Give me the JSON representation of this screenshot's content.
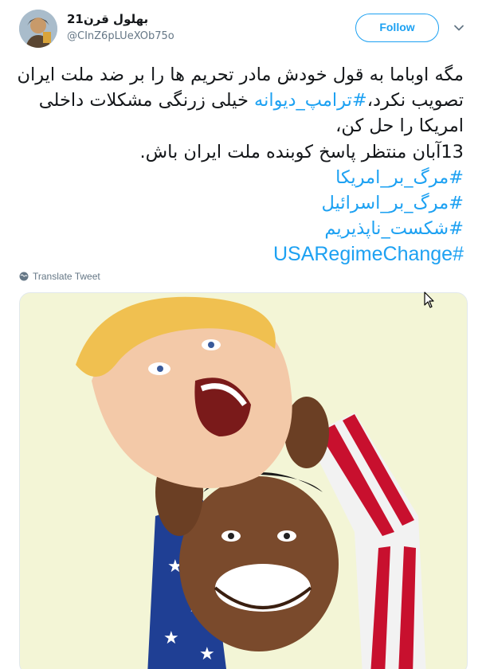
{
  "user": {
    "display_name": "بهلول قرن21",
    "handle": "@CInZ6pLUeXOb75o"
  },
  "follow_label": "Follow",
  "tweet": {
    "line1": "مگه اوباما به قول خودش مادر تحریم ها را بر ضد ملت ایران",
    "line2_before": "تصویب نکرد،",
    "line2_hashtag": "#ترامپ_دیوانه",
    "line2_after": " خیلی زرنگی مشکلات داخلی",
    "line3": "امریکا را حل کن،",
    "line4": "13آبان منتظر پاسخ کوبنده ملت ایران باش.",
    "hashtags": [
      "#مرگ_بر_امریکا",
      "#مرگ_بر_اسرائیل",
      "#شکست_ناپذیریم"
    ],
    "hashtag_en": "#USARegimeChange"
  },
  "translate_label": "Translate Tweet",
  "icons": {
    "caret": "chevron-down-icon",
    "translate": "globe-icon"
  },
  "colors": {
    "link": "#1da1f2",
    "text": "#14171a",
    "secondary": "#657786"
  }
}
